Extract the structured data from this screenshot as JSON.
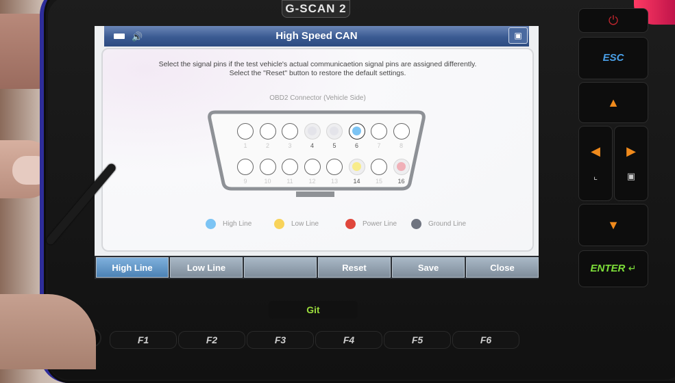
{
  "device": {
    "brand": "G-SCAN 2",
    "logo_text": "Git",
    "hard_keys": {
      "power": "power",
      "esc": "ESC",
      "up": "up",
      "left": "left",
      "right": "right",
      "down": "down",
      "enter": "ENTER"
    },
    "function_keys": [
      "F1",
      "F2",
      "F3",
      "F4",
      "F5",
      "F6"
    ]
  },
  "screen": {
    "title": "High Speed CAN",
    "status_icons": [
      "battery-icon",
      "speaker-icon",
      "screen-capture-icon"
    ],
    "instructions": [
      "Select the signal pins if the test vehicle's actual communicaetion signal pins are assigned differently.",
      "Select the \"Reset\" button to restore the default settings."
    ],
    "connector_label": "OBD2 Connector (Vehicle Side)",
    "pins": [
      {
        "num": "1",
        "state": "empty"
      },
      {
        "num": "2",
        "state": "empty"
      },
      {
        "num": "3",
        "state": "empty"
      },
      {
        "num": "4",
        "state": "ground-faded"
      },
      {
        "num": "5",
        "state": "ground-faded"
      },
      {
        "num": "6",
        "state": "high"
      },
      {
        "num": "7",
        "state": "empty"
      },
      {
        "num": "8",
        "state": "empty"
      },
      {
        "num": "9",
        "state": "empty"
      },
      {
        "num": "10",
        "state": "empty"
      },
      {
        "num": "11",
        "state": "empty"
      },
      {
        "num": "12",
        "state": "empty"
      },
      {
        "num": "13",
        "state": "empty"
      },
      {
        "num": "14",
        "state": "low"
      },
      {
        "num": "15",
        "state": "empty"
      },
      {
        "num": "16",
        "state": "power"
      }
    ],
    "legend": [
      {
        "label": "High Line",
        "color": "#7cc4f4"
      },
      {
        "label": "Low Line",
        "color": "#f8d35a"
      },
      {
        "label": "Power Line",
        "color": "#e0473c"
      },
      {
        "label": "Ground Line",
        "color": "#6f7480"
      }
    ],
    "buttons": [
      {
        "label": "High Line",
        "active": true
      },
      {
        "label": "Low Line",
        "active": false
      },
      {
        "label": "",
        "active": false
      },
      {
        "label": "Reset",
        "active": false
      },
      {
        "label": "Save",
        "active": false
      },
      {
        "label": "Close",
        "active": false
      }
    ]
  },
  "colors": {
    "titlebar": "#3a5a92",
    "high": "#7cc4f4",
    "low": "#f8ec8a",
    "power": "#f0b0b8",
    "ground_faded": "#e4e4ea",
    "esc": "#4aa0e8",
    "arrow": "#f08a1c",
    "enter": "#7ee03a",
    "power_key": "#c0262e"
  }
}
